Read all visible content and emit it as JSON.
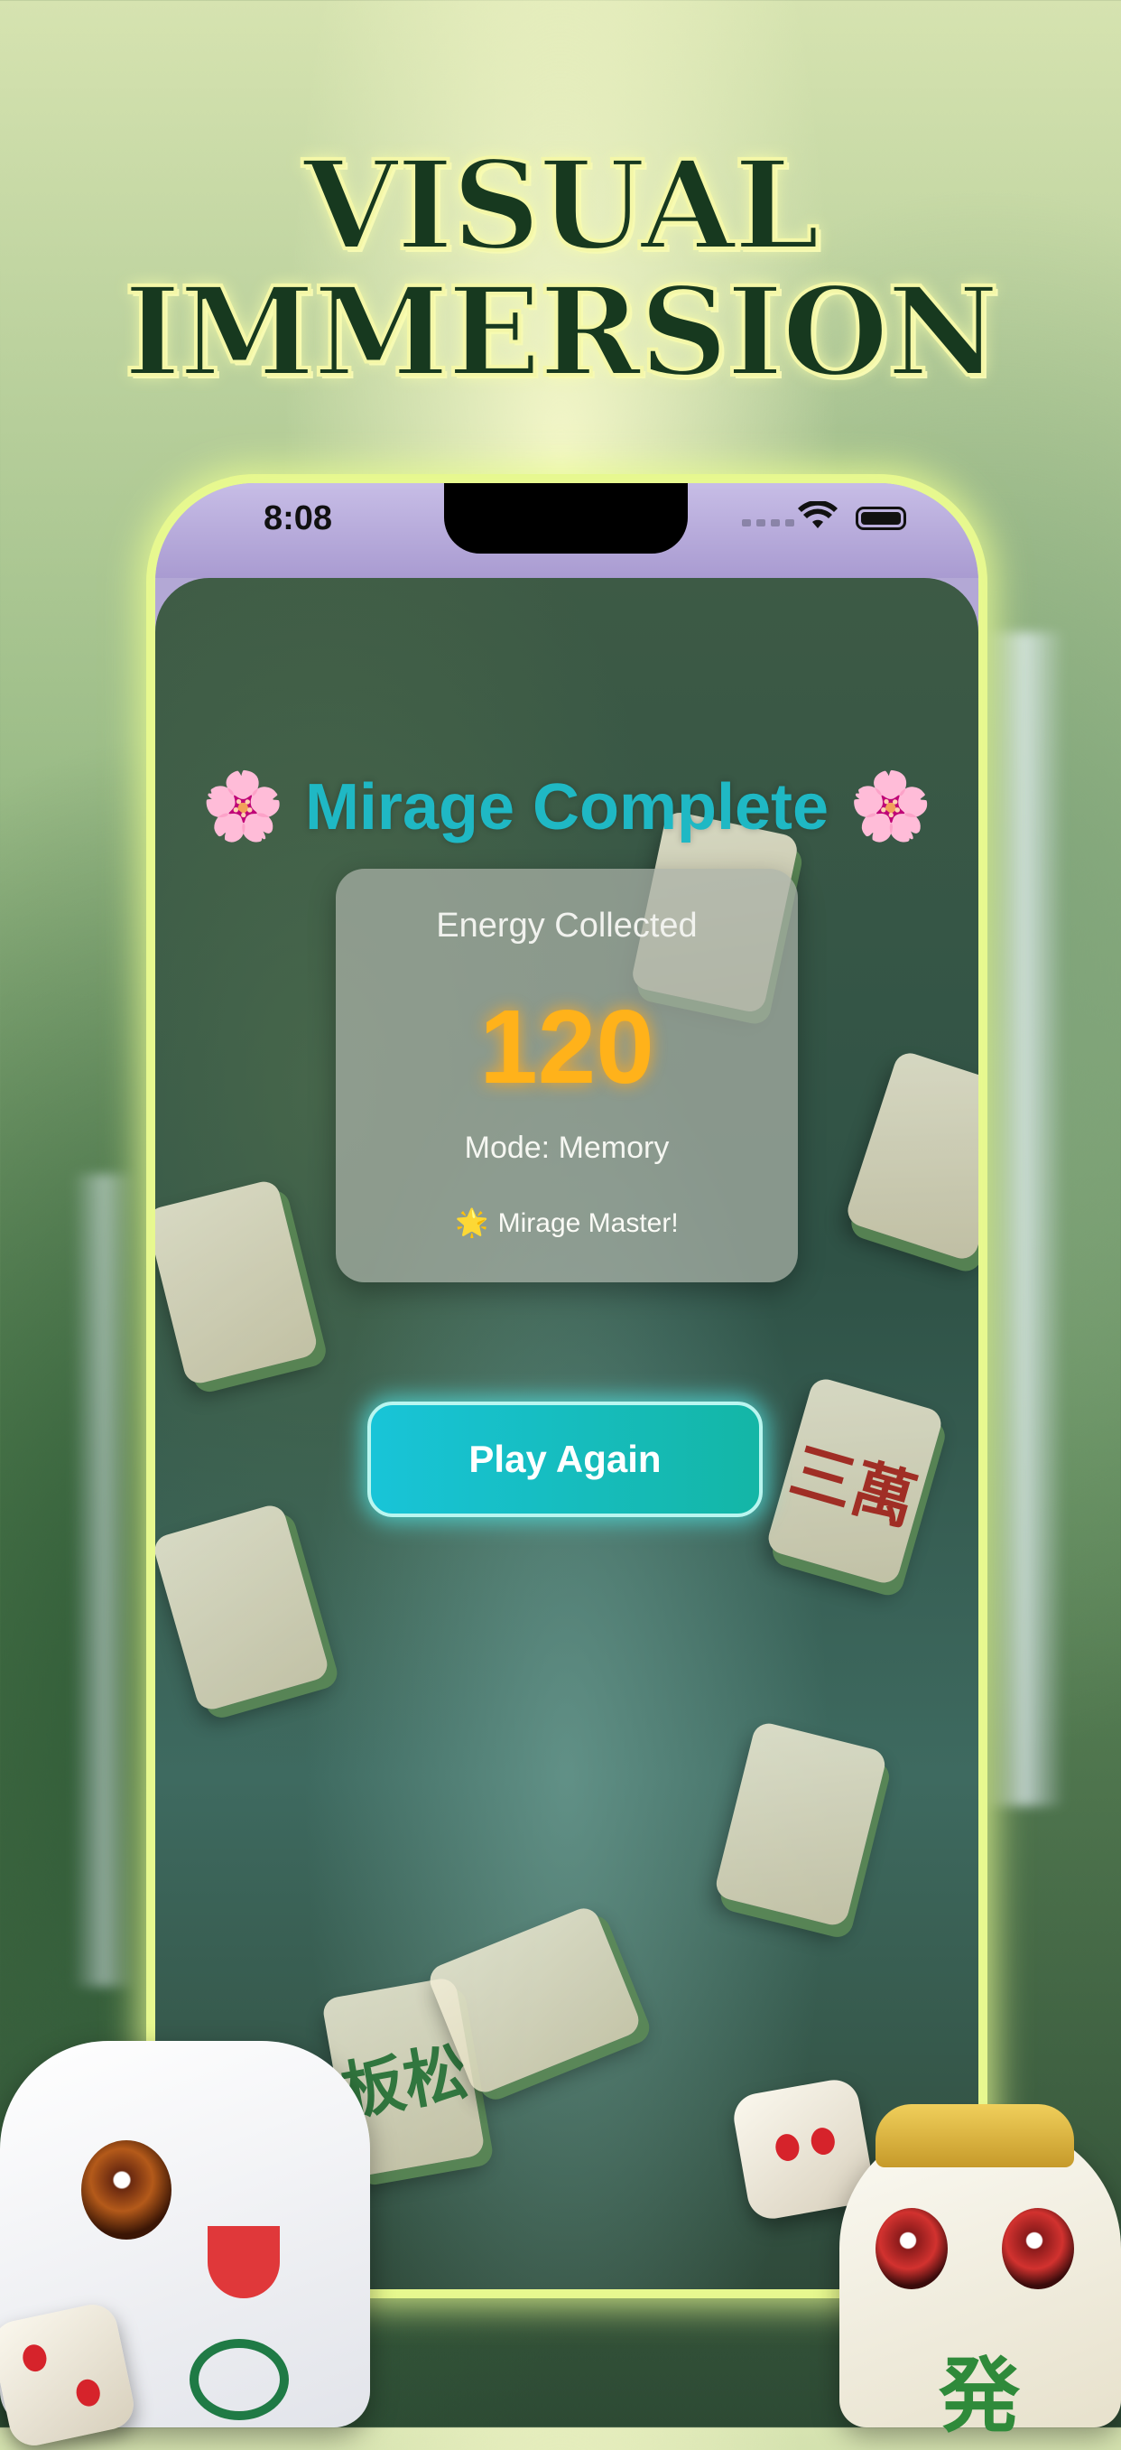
{
  "promo": {
    "headline_line1": "VISUAL",
    "headline_line2": "IMMERSION"
  },
  "status_bar": {
    "time": "8:08"
  },
  "result": {
    "title": "Mirage Complete",
    "flower_icon": "🌸",
    "energy_label": "Energy Collected",
    "energy_value": "120",
    "mode_text": "Mode: Memory",
    "achievement_icon": "🌟",
    "achievement_text": "Mirage Master!"
  },
  "actions": {
    "play_again_label": "Play Again"
  },
  "background_tiles": [
    "三萬",
    "板松"
  ],
  "colors": {
    "title_teal": "#1fb8c4",
    "energy_orange": "#ffb21a",
    "button_teal": "#18c4d8",
    "headline_green": "#17391f",
    "glow_yellow": "#e6f58e"
  }
}
